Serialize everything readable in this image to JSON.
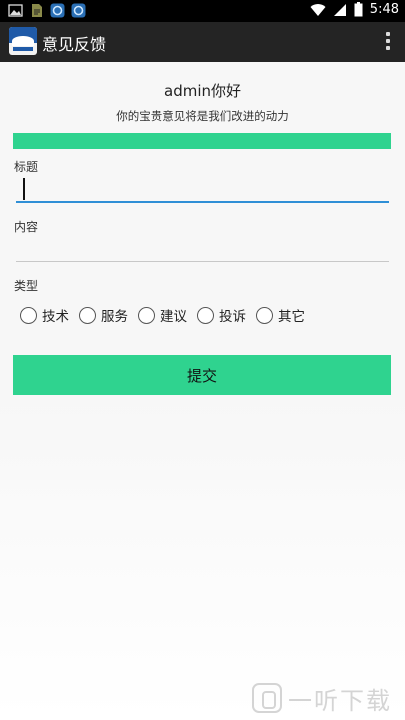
{
  "status_bar": {
    "time": "5:48",
    "left_icons": [
      "image-icon",
      "file-icon",
      "app-icon",
      "app-icon"
    ],
    "right_icons": [
      "wifi-icon",
      "signal-icon",
      "battery-icon"
    ]
  },
  "action_bar": {
    "title": "意见反馈",
    "app_icon": "app-logo",
    "menu_icon": "overflow-menu-icon"
  },
  "form": {
    "greeting": "admin你好",
    "subtitle": "你的宝贵意见将是我们改进的动力",
    "title_label": "标题",
    "title_value": "",
    "content_label": "内容",
    "content_value": "",
    "type_label": "类型",
    "type_options": [
      "技术",
      "服务",
      "建议",
      "投诉",
      "其它"
    ],
    "submit_label": "提交"
  },
  "watermark": {
    "text": "一听下载"
  },
  "colors": {
    "accent": "#2fd38f",
    "action_bar": "#242424",
    "status_bar": "#000000",
    "focus_line": "#2f8fd6"
  }
}
